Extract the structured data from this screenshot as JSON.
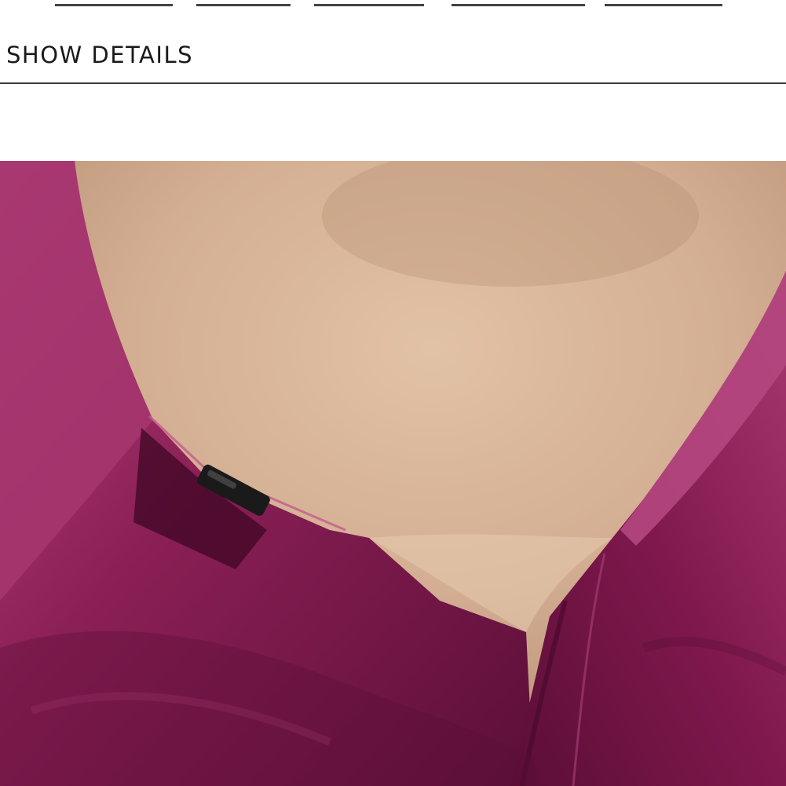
{
  "section": {
    "heading": "SHOW DETAILS"
  },
  "photo": {
    "subject": "shirt-collar-closeup",
    "colors": {
      "fabric": "#8a1f55",
      "fabric_dark": "#4a0a2c",
      "fabric_light": "#b8457e",
      "skin": "#d8b59a",
      "skin_shadow": "#b88f74",
      "button": "#1a1a1a"
    }
  }
}
